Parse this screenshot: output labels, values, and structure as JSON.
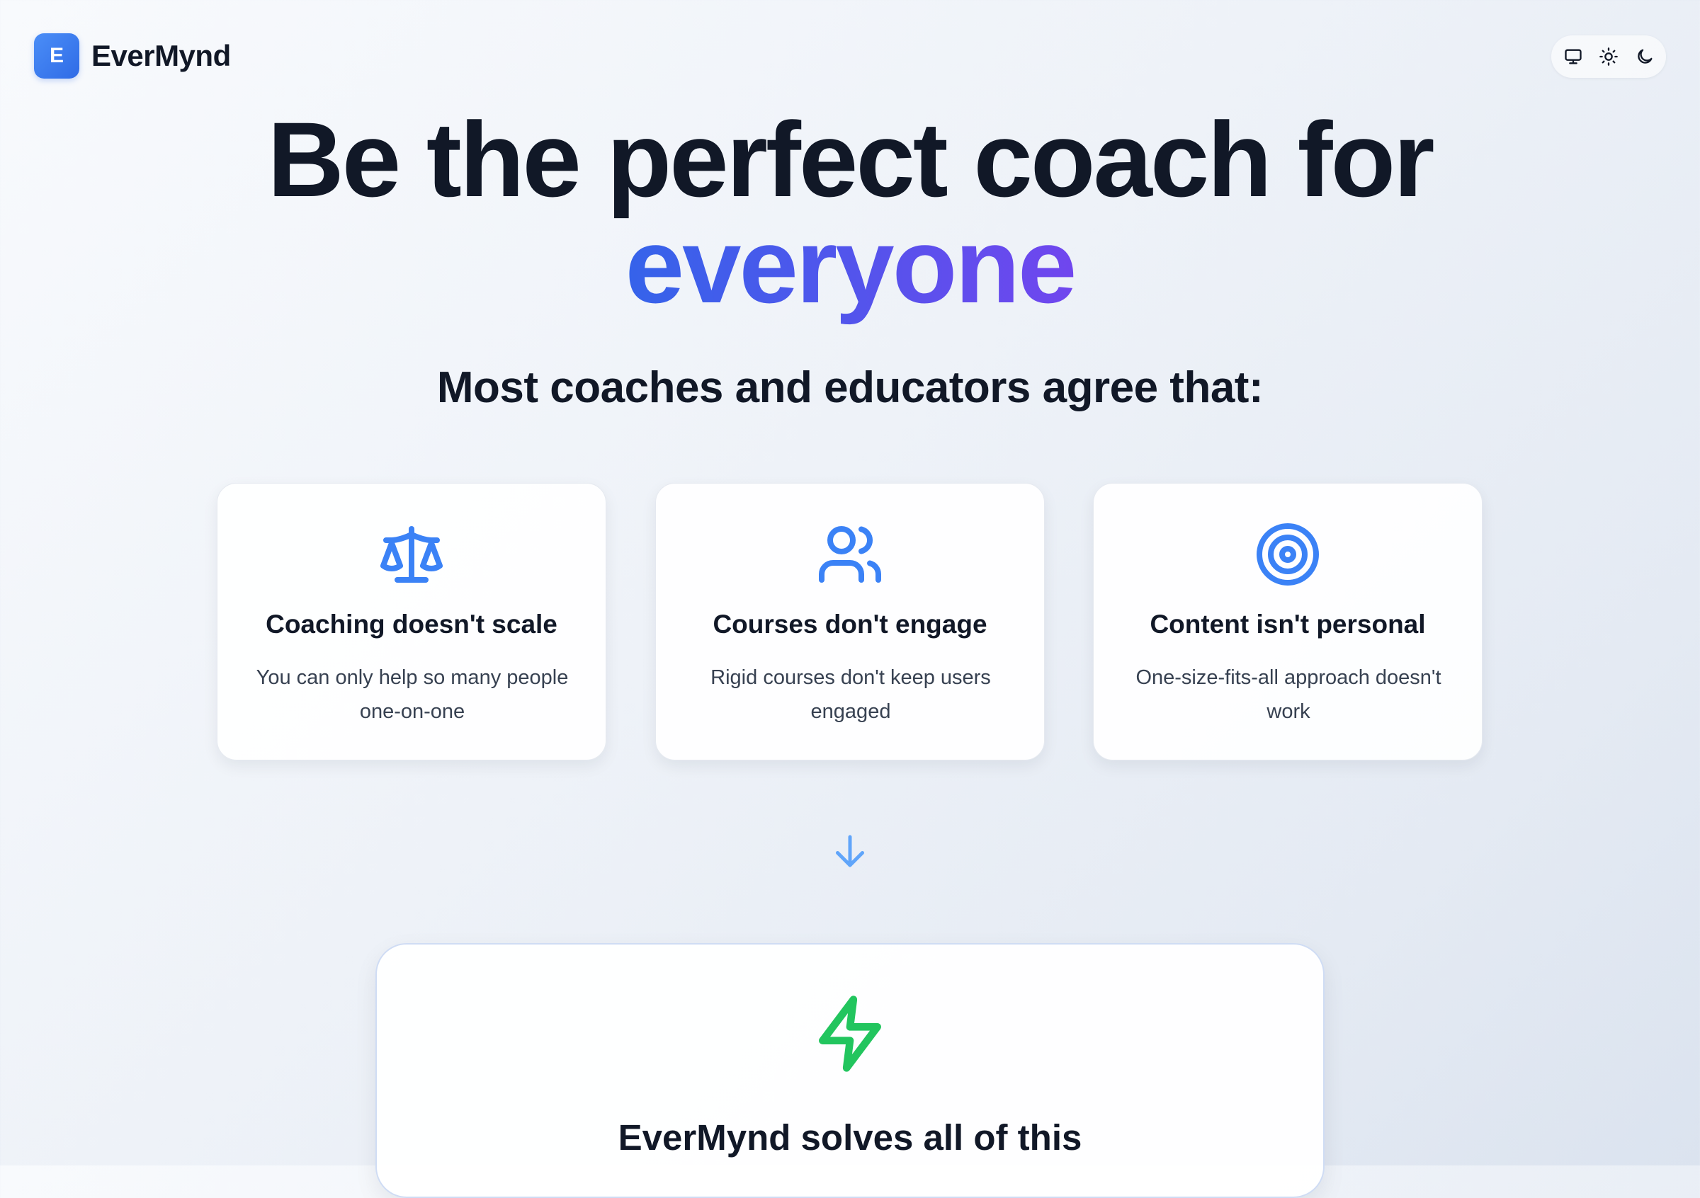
{
  "brand": {
    "logo_letter": "E",
    "name": "EverMynd"
  },
  "theme_toggle": {
    "options": [
      "monitor-icon",
      "sun-icon",
      "moon-icon"
    ]
  },
  "hero": {
    "line1": "Be the perfect coach for",
    "line2": "everyone",
    "gradient_colors": [
      "#3563ea",
      "#7046ee"
    ]
  },
  "subheading": "Most coaches and educators agree that:",
  "cards": [
    {
      "icon": "scale-icon",
      "title": "Coaching doesn't scale",
      "description": "You can only help so many people one-on-one"
    },
    {
      "icon": "users-icon",
      "title": "Courses don't engage",
      "description": "Rigid courses don't keep users engaged"
    },
    {
      "icon": "target-icon",
      "title": "Content isn't personal",
      "description": "One-size-fits-all approach doesn't work"
    }
  ],
  "solution": {
    "icon": "lightning-icon",
    "title": "EverMynd solves all of this"
  },
  "colors": {
    "accent_blue": "#3b82f6",
    "accent_green": "#22c55e",
    "text_dark": "#111827"
  }
}
